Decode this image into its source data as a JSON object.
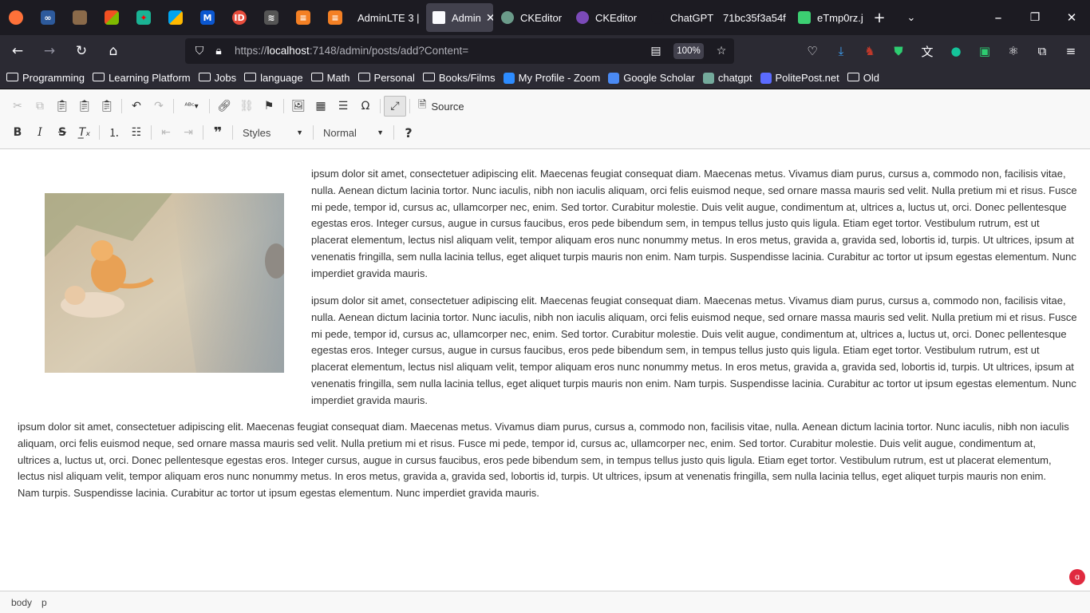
{
  "browser": {
    "tabs": [
      {
        "label": "AdminLTE 3 |",
        "color": "#2b2a33"
      },
      {
        "label": "Admin",
        "color": "#1c1b22",
        "active": true
      },
      {
        "label": "CKEditor",
        "color": "#1c1b22"
      },
      {
        "label": "CKEditor",
        "color": "#1c1b22"
      },
      {
        "label": "ChatGPT -",
        "color": "#1c1b22"
      },
      {
        "label": "71bc35f3a54f",
        "color": "#1c1b22"
      },
      {
        "label": "eTmp0rz.j",
        "color": "#1c1b22"
      }
    ],
    "tab_close": "✕",
    "new_tab": "+",
    "url": {
      "host": "localhost",
      "prefix": "https://",
      "rest": ":7148/admin/posts/add?Content="
    },
    "zoom": "100%",
    "bookmarks": [
      {
        "label": "Programming",
        "type": "folder"
      },
      {
        "label": "Learning Platform",
        "type": "folder"
      },
      {
        "label": "Jobs",
        "type": "folder"
      },
      {
        "label": "language",
        "type": "folder"
      },
      {
        "label": "Math",
        "type": "folder"
      },
      {
        "label": "Personal",
        "type": "folder"
      },
      {
        "label": "Books/Films",
        "type": "folder"
      },
      {
        "label": "My Profile - Zoom",
        "type": "site",
        "color": "#2d8cff"
      },
      {
        "label": "Google Scholar",
        "type": "site",
        "color": "#4a8af4"
      },
      {
        "label": "chatgpt",
        "type": "site",
        "color": "#74aa9c"
      },
      {
        "label": "PolitePost.net",
        "type": "site",
        "color": "#5b6bff"
      },
      {
        "label": "Old",
        "type": "folder"
      }
    ]
  },
  "editor": {
    "toolbar": {
      "source_label": "Source",
      "styles_label": "Styles",
      "format_label": "Normal"
    },
    "paragraphs": [
      "ipsum dolor sit amet, consectetuer adipiscing elit. Maecenas feugiat consequat diam. Maecenas metus. Vivamus diam purus, cursus a, commodo non, facilisis vitae, nulla. Aenean dictum lacinia tortor. Nunc iaculis, nibh non iaculis aliquam, orci felis euismod neque, sed ornare massa mauris sed velit. Nulla pretium mi et risus. Fusce mi pede, tempor id, cursus ac, ullamcorper nec, enim. Sed tortor. Curabitur molestie. Duis velit augue, condimentum at, ultrices a, luctus ut, orci. Donec pellentesque egestas eros. Integer cursus, augue in cursus faucibus, eros pede bibendum sem, in tempus tellus justo quis ligula. Etiam eget tortor. Vestibulum rutrum, est ut placerat elementum, lectus nisl aliquam velit, tempor aliquam eros nunc nonummy metus. In eros metus, gravida a, gravida sed, lobortis id, turpis. Ut ultrices, ipsum at venenatis fringilla, sem nulla lacinia tellus, eget aliquet turpis mauris non enim. Nam turpis. Suspendisse lacinia. Curabitur ac tortor ut ipsum egestas elementum. Nunc imperdiet gravida mauris.",
      "ipsum dolor sit amet, consectetuer adipiscing elit. Maecenas feugiat consequat diam. Maecenas metus. Vivamus diam purus, cursus a, commodo non, facilisis vitae, nulla. Aenean dictum lacinia tortor. Nunc iaculis, nibh non iaculis aliquam, orci felis euismod neque, sed ornare massa mauris sed velit. Nulla pretium mi et risus. Fusce mi pede, tempor id, cursus ac, ullamcorper nec, enim. Sed tortor. Curabitur molestie. Duis velit augue, condimentum at, ultrices a, luctus ut, orci. Donec pellentesque egestas eros. Integer cursus, augue in cursus faucibus, eros pede bibendum sem, in tempus tellus justo quis ligula. Etiam eget tortor. Vestibulum rutrum, est ut placerat elementum, lectus nisl aliquam velit, tempor aliquam eros nunc nonummy metus. In eros metus, gravida a, gravida sed, lobortis id, turpis. Ut ultrices, ipsum at venenatis fringilla, sem nulla lacinia tellus, eget aliquet turpis mauris non enim. Nam turpis. Suspendisse lacinia. Curabitur ac tortor ut ipsum egestas elementum. Nunc imperdiet gravida mauris.",
      "ipsum dolor sit amet, consectetuer adipiscing elit. Maecenas feugiat consequat diam. Maecenas metus. Vivamus diam purus, cursus a, commodo non, facilisis vitae, nulla. Aenean dictum lacinia tortor. Nunc iaculis, nibh non iaculis aliquam, orci felis euismod neque, sed ornare massa mauris sed velit. Nulla pretium mi et risus. Fusce mi pede, tempor id, cursus ac, ullamcorper nec, enim. Sed tortor. Curabitur molestie. Duis velit augue, condimentum at, ultrices a, luctus ut, orci. Donec pellentesque egestas eros. Integer cursus, augue in cursus faucibus, eros pede bibendum sem, in tempus tellus justo quis ligula. Etiam eget tortor. Vestibulum rutrum, est ut placerat elementum, lectus nisl aliquam velit, tempor aliquam eros nunc nonummy metus. In eros metus, gravida a, gravida sed, lobortis id, turpis. Ut ultrices, ipsum at venenatis fringilla, sem nulla lacinia tellus, eget aliquet turpis mauris non enim. Nam turpis. Suspendisse lacinia. Curabitur ac tortor ut ipsum egestas elementum. Nunc imperdiet gravida mauris."
    ],
    "statusbar": [
      "body",
      "p"
    ]
  },
  "colors": {
    "chrome_dark": "#1c1b22",
    "chrome": "#2b2a33",
    "spell_underline": "#e01b24",
    "toolbar_bg": "#f8f8f8"
  }
}
